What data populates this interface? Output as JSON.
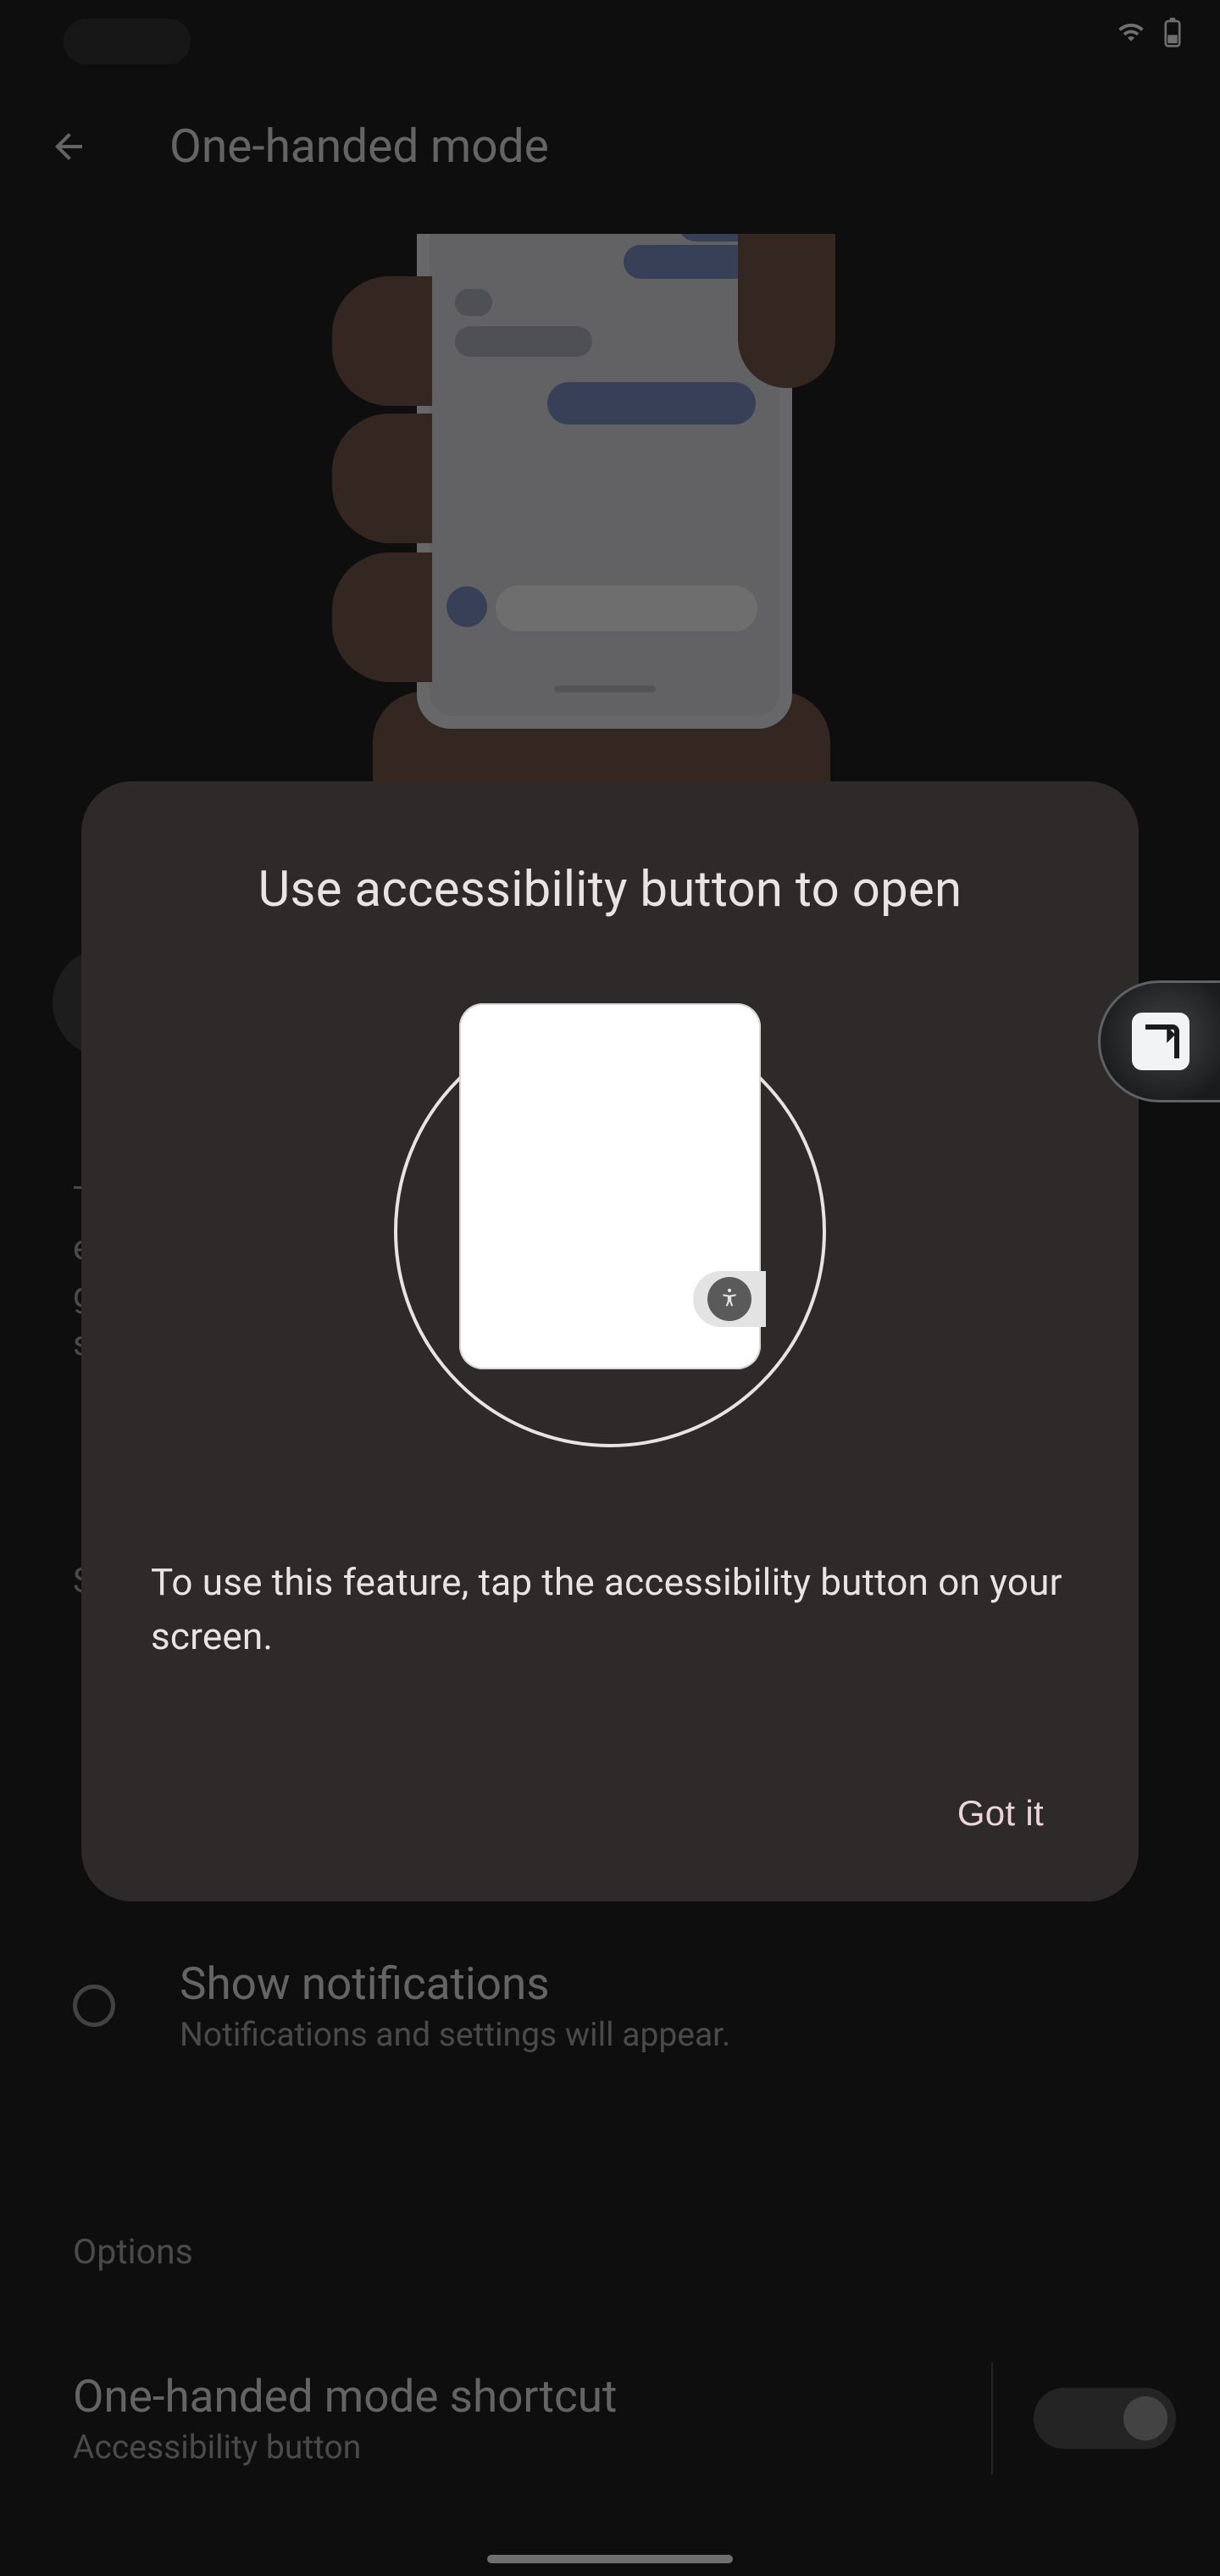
{
  "status": {
    "wifi_icon": "wifi",
    "battery_icon": "battery"
  },
  "appbar": {
    "title": "One-handed mode"
  },
  "bg": {
    "letters": "T\ne\ng\ns",
    "sections_label": "S",
    "radio": {
      "title": "Show notifications",
      "subtitle": "Notifications and settings will appear."
    },
    "options_header": "Options",
    "shortcut": {
      "title": "One-handed mode shortcut",
      "subtitle": "Accessibility button"
    }
  },
  "dialog": {
    "title": "Use accessibility button to open",
    "body": "To use this feature, tap the accessibility button on your screen.",
    "confirm": "Got it"
  }
}
